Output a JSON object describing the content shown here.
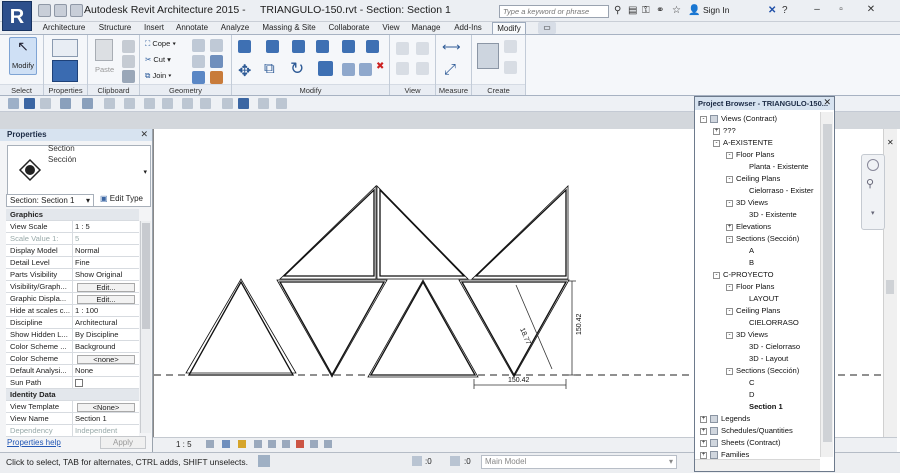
{
  "app": {
    "name": "Autodesk Revit Architecture 2015 -",
    "document": "TRIANGULO-150.rvt - Section: Section 1",
    "search_placeholder": "Type a keyword or phrase",
    "sign_in": "Sign In",
    "logo_letter": "R"
  },
  "ribbon_tabs": [
    "Architecture",
    "Structure",
    "Insert",
    "Annotate",
    "Analyze",
    "Massing & Site",
    "Collaborate",
    "View",
    "Manage",
    "Add-Ins",
    "Modify"
  ],
  "ribbon": {
    "panels": {
      "select": "Select",
      "properties": "Properties",
      "clipboard": "Clipboard",
      "geometry": "Geometry",
      "modify": "Modify",
      "view": "View",
      "measure": "Measure",
      "create": "Create"
    },
    "modify_btn": "Modify",
    "paste_btn": "Paste",
    "cope": "Cope",
    "cut": "Cut",
    "join": "Join"
  },
  "properties": {
    "title": "Properties",
    "family": "Section",
    "type": "Sección",
    "selector": "Section: Section 1",
    "edit_type": "Edit Type",
    "rows": [
      {
        "k": "Graphics",
        "v": "",
        "group": true
      },
      {
        "k": "View Scale",
        "v": "1 : 5"
      },
      {
        "k": "Scale Value  1:",
        "v": "5",
        "dim": true
      },
      {
        "k": "Display Model",
        "v": "Normal"
      },
      {
        "k": "Detail Level",
        "v": "Fine"
      },
      {
        "k": "Parts Visibility",
        "v": "Show Original"
      },
      {
        "k": "Visibility/Graph...",
        "v": "Edit...",
        "btn": true
      },
      {
        "k": "Graphic Displa...",
        "v": "Edit...",
        "btn": true
      },
      {
        "k": "Hide at scales c...",
        "v": "1 : 100"
      },
      {
        "k": "Discipline",
        "v": "Architectural"
      },
      {
        "k": "Show Hidden L...",
        "v": "By Discipline"
      },
      {
        "k": "Color Scheme ...",
        "v": "Background"
      },
      {
        "k": "Color Scheme",
        "v": "<none>",
        "btn": true
      },
      {
        "k": "Default Analysi...",
        "v": "None"
      },
      {
        "k": "Sun Path",
        "v": "",
        "check": true
      },
      {
        "k": "Identity Data",
        "v": "",
        "group": true
      },
      {
        "k": "View Template",
        "v": "<None>",
        "btn": true
      },
      {
        "k": "View Name",
        "v": "Section 1"
      },
      {
        "k": "Dependency",
        "v": "Independent",
        "dim": true
      }
    ],
    "help": "Properties help",
    "apply": "Apply"
  },
  "canvas": {
    "dim_diag": "18.77",
    "dim_vert": "150.42",
    "dim_horiz": "150.42"
  },
  "view_control": {
    "scale": "1 : 5"
  },
  "status": {
    "text": "Click to select, TAB for alternates, CTRL adds, SHIFT unselects.",
    "zero1": ":0",
    "zero2": ":0",
    "model": "Main Model"
  },
  "project_browser": {
    "title": "Project Browser - TRIANGULO-150...",
    "items": [
      {
        "t": "Views (Contract)",
        "d": 0,
        "exp": "-"
      },
      {
        "t": "???",
        "d": 1,
        "exp": "+"
      },
      {
        "t": "A-EXISTENTE",
        "d": 1,
        "exp": "-"
      },
      {
        "t": "Floor Plans",
        "d": 2,
        "exp": "-"
      },
      {
        "t": "Planta - Existente",
        "d": 3
      },
      {
        "t": "Ceiling Plans",
        "d": 2,
        "exp": "-"
      },
      {
        "t": "Cielorraso - Exister",
        "d": 3
      },
      {
        "t": "3D Views",
        "d": 2,
        "exp": "-"
      },
      {
        "t": "3D - Existente",
        "d": 3
      },
      {
        "t": "Elevations",
        "d": 2,
        "exp": "+"
      },
      {
        "t": "Sections (Sección)",
        "d": 2,
        "exp": "-"
      },
      {
        "t": "A",
        "d": 3
      },
      {
        "t": "B",
        "d": 3
      },
      {
        "t": "C-PROYECTO",
        "d": 1,
        "exp": "-"
      },
      {
        "t": "Floor Plans",
        "d": 2,
        "exp": "-"
      },
      {
        "t": "LAYOUT",
        "d": 3
      },
      {
        "t": "Ceiling Plans",
        "d": 2,
        "exp": "-"
      },
      {
        "t": "CIELORRASO",
        "d": 3
      },
      {
        "t": "3D Views",
        "d": 2,
        "exp": "-"
      },
      {
        "t": "3D - Cielorraso",
        "d": 3
      },
      {
        "t": "3D - Layout",
        "d": 3
      },
      {
        "t": "Sections (Sección)",
        "d": 2,
        "exp": "-"
      },
      {
        "t": "C",
        "d": 3
      },
      {
        "t": "D",
        "d": 3
      },
      {
        "t": "Section 1",
        "d": 3,
        "bold": true
      },
      {
        "t": "Legends",
        "d": 0,
        "exp": "+",
        "icon": true
      },
      {
        "t": "Schedules/Quantities",
        "d": 0,
        "exp": "+",
        "icon": true
      },
      {
        "t": "Sheets (Contract)",
        "d": 0,
        "exp": "+",
        "icon": true
      },
      {
        "t": "Families",
        "d": 0,
        "exp": "+",
        "icon": true
      }
    ]
  }
}
